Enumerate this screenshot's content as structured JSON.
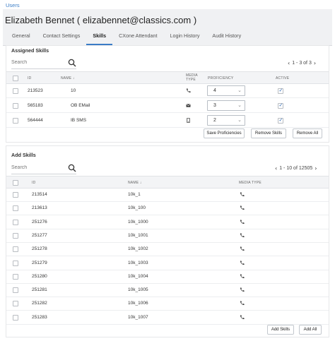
{
  "breadcrumb": "Users",
  "page_title": "Elizabeth Bennet ( elizabennet@classics.com )",
  "tabs": [
    {
      "label": "General"
    },
    {
      "label": "Contact Settings"
    },
    {
      "label": "Skills"
    },
    {
      "label": "CXone Attendant"
    },
    {
      "label": "Login History"
    },
    {
      "label": "Audit History"
    }
  ],
  "active_tab": "Skills",
  "colors": {
    "accent": "#3a7cc6",
    "header_bg": "#f0f1f3"
  },
  "assigned": {
    "title": "Assigned Skills",
    "search_placeholder": "Search",
    "pager": "1 - 3 of 3",
    "pager_prev_icon": "chevron-left-icon",
    "pager_next_icon": "chevron-right-icon",
    "columns": {
      "id": "ID",
      "name": "NAME ↓",
      "media_type_1": "MEDIA",
      "media_type_2": "TYPE",
      "proficiency": "PROFICIENCY",
      "active": "ACTIVE"
    },
    "rows": [
      {
        "id": "213523",
        "name": "10",
        "media_icon": "phone-icon",
        "proficiency": "4",
        "active": true
      },
      {
        "id": "565183",
        "name": "OB EMail",
        "media_icon": "email-icon",
        "proficiency": "3",
        "active": true
      },
      {
        "id": "564444",
        "name": "IB SMS",
        "media_icon": "mobile-icon",
        "proficiency": "2",
        "active": true
      }
    ],
    "buttons": {
      "save": "Save Proficiencies",
      "remove": "Remove Skills",
      "remove_all": "Remove All"
    }
  },
  "add": {
    "title": "Add Skills",
    "search_placeholder": "Search",
    "pager": "1 - 10 of 12505",
    "columns": {
      "id": "ID",
      "name": "NAME ↓",
      "media_type": "MEDIA TYPE"
    },
    "rows": [
      {
        "id": "213514",
        "name": "10k_1",
        "media_icon": "phone-icon"
      },
      {
        "id": "213613",
        "name": "10k_100",
        "media_icon": "phone-icon"
      },
      {
        "id": "251276",
        "name": "10k_1000",
        "media_icon": "phone-icon"
      },
      {
        "id": "251277",
        "name": "10k_1001",
        "media_icon": "phone-icon"
      },
      {
        "id": "251278",
        "name": "10k_1002",
        "media_icon": "phone-icon"
      },
      {
        "id": "251279",
        "name": "10k_1003",
        "media_icon": "phone-icon"
      },
      {
        "id": "251280",
        "name": "10k_1004",
        "media_icon": "phone-icon"
      },
      {
        "id": "251281",
        "name": "10k_1005",
        "media_icon": "phone-icon"
      },
      {
        "id": "251282",
        "name": "10k_1006",
        "media_icon": "phone-icon"
      },
      {
        "id": "251283",
        "name": "10k_1007",
        "media_icon": "phone-icon"
      }
    ],
    "buttons": {
      "add": "Add Skills",
      "add_all": "Add All"
    }
  }
}
